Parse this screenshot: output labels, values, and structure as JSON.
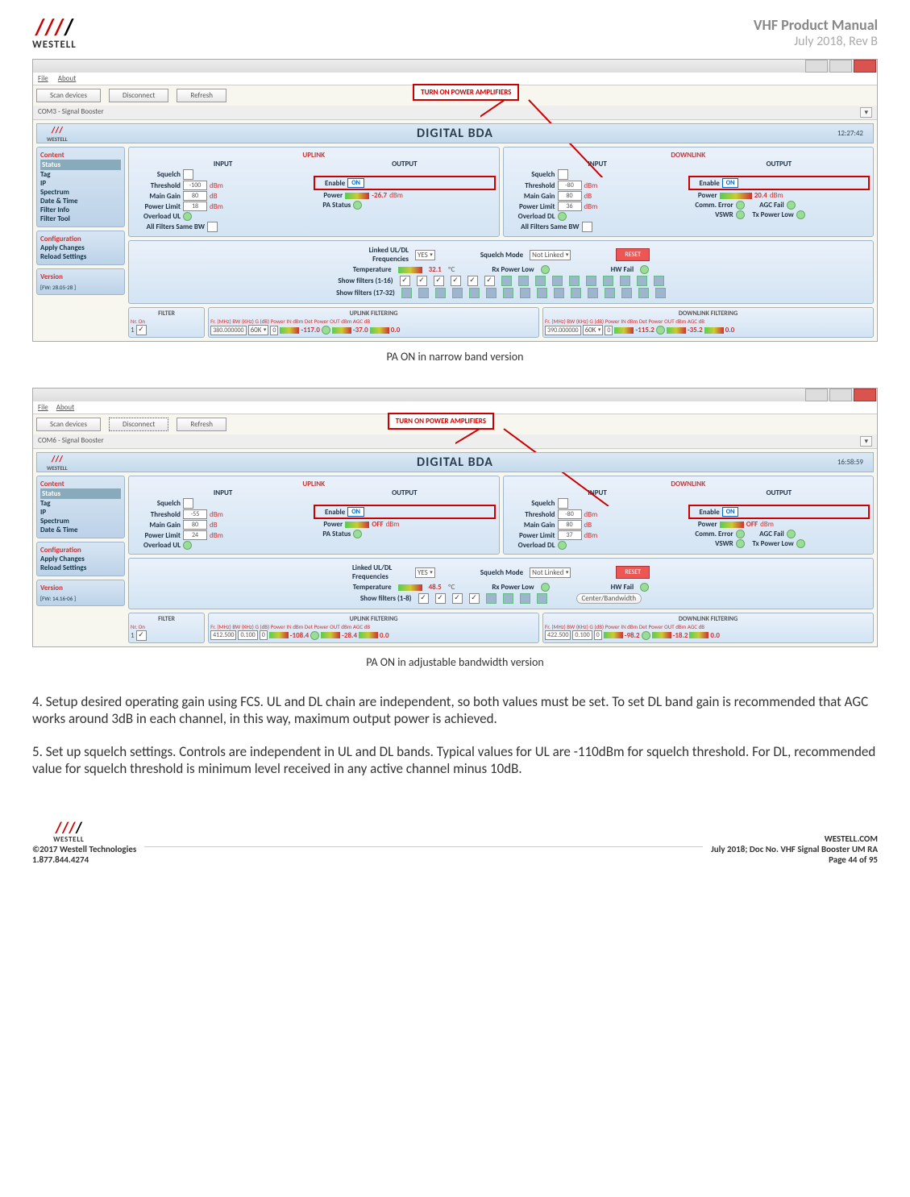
{
  "doc": {
    "title": "VHF Product Manual",
    "subtitle": "July 2018, Rev B",
    "brand": "WESTELL",
    "caption1": "PA ON in narrow band version",
    "caption2": "PA ON in adjustable bandwidth version",
    "step4": "4. Setup desired operating gain using FCS. UL and DL chain are independent, so both values must be set. To set DL band gain is recommended that AGC works around 3dB in each channel, in this way, maximum output power is achieved.",
    "step5": "5. Set up squelch settings. Controls are independent in UL and DL bands. Typical values for UL are -110dBm for squelch threshold. For DL, recommended value for squelch threshold is minimum level received in any active channel minus 10dB.",
    "footer_left1": "©2017 Westell Technologies",
    "footer_left2": "1.877.844.4274",
    "footer_right_url": "WESTELL.COM",
    "footer_right1": "July 2018; Doc No. VHF Signal Booster UM RA",
    "footer_right2": "Page 44 of 95"
  },
  "shot1": {
    "menu_file": "File",
    "menu_about": "About",
    "btn_scan": "Scan devices",
    "btn_disc": "Disconnect",
    "btn_refresh": "Refresh",
    "com": "COM3 - Signal Booster",
    "clock": "12:27:42",
    "title": "DIGITAL BDA",
    "callout": "TURN ON POWER AMPLIFIERS",
    "sidebar": {
      "hdr1": "Content",
      "items1": [
        "Status",
        "Tag",
        "IP",
        "Spectrum",
        "Date & Time",
        "Filter Info",
        "Filter Tool"
      ],
      "hdr2": "Configuration",
      "items2": [
        "Apply Changes",
        "Reload Settings"
      ],
      "hdr3": "Version",
      "foot": "[FW: 28.05-28 ]"
    },
    "uplink": {
      "title": "UPLINK",
      "input": "INPUT",
      "output": "OUTPUT",
      "squelch": "Squelch",
      "threshold": "Threshold",
      "threshold_val": "-100",
      "threshold_unit": "dBm",
      "gain": "Main Gain",
      "gain_val": "80",
      "gain_unit": "dB",
      "plimit": "Power Limit",
      "plimit_val": "18",
      "plimit_unit": "dBm",
      "overload": "Overload UL",
      "allfilt": "All Filters Same BW",
      "enable": "Enable",
      "on": "ON",
      "power": "Power",
      "power_val": "-26.7",
      "power_unit": "dBm",
      "pastatus": "PA Status"
    },
    "downlink": {
      "title": "DOWNLINK",
      "threshold_val": "-80",
      "gain_val": "80",
      "plimit_val": "36",
      "overload": "Overload DL",
      "power_val": "20.4",
      "commerr": "Comm. Error",
      "vswr": "VSWR",
      "agc": "AGC Fail",
      "txlow": "Tx Power Low"
    },
    "mid": {
      "linked": "Linked UL/DL Frequencies",
      "linked_val": "YES",
      "sqmode": "Squelch Mode",
      "sqmode_val": "Not Linked",
      "reset": "RESET",
      "temp": "Temperature",
      "temp_val": "32.1",
      "temp_unit": "ºC",
      "rxlow": "Rx Power Low",
      "hwfail": "HW Fail",
      "show1": "Show filters (1-16)",
      "show2": "Show filters (17-32)"
    },
    "filter": {
      "fh": "FILTER",
      "ufh": "UPLINK FILTERING",
      "dfh": "DOWNLINK FILTERING",
      "nr_on": "Nr.  On",
      "cols": "Fr. (MHz)    BW (KHz)  G (dB) Power IN   dBm   Det Power OUT   dBm      AGC        dB",
      "row": {
        "n": "1",
        "freq": "380.000000",
        "bw": "60K",
        "g": "0",
        "pin": "-117.0",
        "pout": "-37.0",
        "agc": "0.0",
        "d_freq": "390.000000",
        "d_bw": "60K",
        "d_g": "0",
        "d_pin": "-115.2",
        "d_pout": "-35.2",
        "d_agc": "0.0"
      }
    }
  },
  "shot2": {
    "com": "COM6 - Signal Booster",
    "clock": "16:58:59",
    "sidebar_items1": [
      "Status",
      "Tag",
      "IP",
      "Spectrum",
      "Date & Time"
    ],
    "sidebar_foot": "[FW: 14.16-06 ]",
    "uplink": {
      "threshold_val": "-55",
      "gain_val": "80",
      "plimit_val": "24",
      "power_state": "OFF"
    },
    "downlink": {
      "threshold_val": "-80",
      "gain_val": "80",
      "plimit_val": "37",
      "power_state": "OFF"
    },
    "mid": {
      "temp_val": "48.5",
      "show1": "Show filters (1-8)",
      "cb": "Center/Bandwidth"
    },
    "filter": {
      "row": {
        "freq": "412.500",
        "bw": "0.100",
        "g": "0",
        "pin": "-108.4",
        "pout": "-28.4",
        "agc": "0.0",
        "d_freq": "422.500",
        "d_bw": "0.100",
        "d_g": "0",
        "d_pin": "-98.2",
        "d_pout": "-18.2",
        "d_agc": "0.0"
      }
    }
  }
}
